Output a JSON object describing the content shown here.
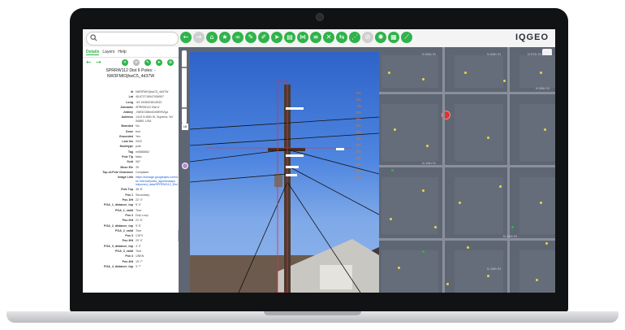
{
  "app": {
    "logo_text": "IQGEO",
    "brand_color": "#2fb34a",
    "search_icon": "search-icon"
  },
  "toolbar": {
    "tools": [
      {
        "icon": "back-icon",
        "glyph": "←"
      },
      {
        "icon": "forward-icon",
        "glyph": "→",
        "disabled": true
      },
      {
        "icon": "home-icon",
        "glyph": "⌂"
      },
      {
        "icon": "star-icon",
        "glyph": "★"
      },
      {
        "icon": "link-icon",
        "glyph": "∞"
      },
      {
        "icon": "edit-icon",
        "glyph": "✎"
      },
      {
        "icon": "pencil-icon",
        "glyph": "✐"
      },
      {
        "icon": "navigate-icon",
        "glyph": "➤"
      },
      {
        "icon": "print-icon",
        "glyph": "▤"
      },
      {
        "icon": "network-icon",
        "glyph": "⋈"
      },
      {
        "icon": "list-icon",
        "glyph": "≡"
      },
      {
        "icon": "tools-icon",
        "glyph": "✕"
      },
      {
        "icon": "shuffle-icon",
        "glyph": "⇆"
      },
      {
        "icon": "share-icon",
        "glyph": "⋰"
      },
      {
        "icon": "block-icon",
        "glyph": "⊘",
        "disabled": true
      },
      {
        "icon": "settings-icon",
        "glyph": "✺"
      },
      {
        "icon": "map-icon",
        "glyph": "▦"
      },
      {
        "icon": "measure-icon",
        "glyph": "⟋"
      }
    ]
  },
  "panel": {
    "tabs": [
      "Details",
      "Layers",
      "Help"
    ],
    "title_line1": "SPRRW112 Dist 6 Poles: -",
    "title_line2": "NW3FMIOjhwC5_4d37W",
    "details": [
      {
        "k": "Id",
        "v": "NW3FMIOjhwC5_4d37W"
      },
      {
        "k": "Lat",
        "v": "46.672716947006907"
      },
      {
        "k": "Long",
        "v": "-92.1926324814533"
      },
      {
        "k": "Jobname",
        "v": "SPRRW112 Dist 6"
      },
      {
        "k": "Jobkey",
        "v": "-NW3O38bmDx9lEfHZgz"
      },
      {
        "k": "Address",
        "v": "1415 N 56th St, Superior, WI 54880, USA"
      },
      {
        "k": "Branded",
        "v": "No"
      },
      {
        "k": "Done",
        "v": "true"
      },
      {
        "k": "Grounded",
        "v": "Yes"
      },
      {
        "k": "Last Ins",
        "v": "2022"
      },
      {
        "k": "Nodetype",
        "v": "pole"
      },
      {
        "k": "Tag",
        "v": "m5585662"
      },
      {
        "k": "Pole Tip",
        "v": "false"
      },
      {
        "k": "Scid",
        "v": "067"
      },
      {
        "k": "Mesn Ele",
        "v": "39"
      },
      {
        "k": "Top-of-Pole Clearance",
        "v": "Compliant"
      },
      {
        "k": "Image Link",
        "v": "https://storage.googleapis.com/dp-ke internal/poles_agent/katapu stkponed_data/SPRRW112_Dist_6_export/images/61.jpg",
        "link": true
      },
      {
        "k": "Pole Top",
        "v": "35' 8\""
      },
      {
        "k": "Pos 1",
        "v": "Secondary"
      },
      {
        "k": "Pos 1Ht",
        "v": "22' 4\""
      },
      {
        "k": "POA_1_distance_top",
        "v": "6' 4\""
      },
      {
        "k": "POA_1_valid",
        "v": "True"
      },
      {
        "k": "Pos 2",
        "v": "Drip Loop"
      },
      {
        "k": "Pos 2Ht",
        "v": "21' 6\""
      },
      {
        "k": "POA_2_distance_top",
        "v": "5' 6\""
      },
      {
        "k": "POA_2_valid",
        "v": "True"
      },
      {
        "k": "Pos 3",
        "v": "CATV"
      },
      {
        "k": "Pos 3Ht",
        "v": "20' 4\""
      },
      {
        "k": "POA_3_distance_top",
        "v": "4' 4\""
      },
      {
        "k": "POA_3_valid",
        "v": "True"
      },
      {
        "k": "Pos 4",
        "v": "UNKN"
      },
      {
        "k": "Pos 4Ht",
        "v": "19' 7\""
      },
      {
        "k": "POA_4_distance_top",
        "v": "3' 7\""
      }
    ]
  },
  "map": {
    "zoom_level": "18",
    "street_labels": [
      "N 55th St",
      "N 56th St",
      "N 57th St",
      "N 58th St",
      "N 15th St",
      "N 14th St",
      "N 16th St"
    ]
  },
  "photo": {
    "measurements": [
      "0%",
      "0%",
      "45",
      "0%",
      "0%",
      "0%",
      "0%",
      "0%",
      "0%",
      "0%",
      "0%",
      "0%",
      "0%",
      "0%"
    ]
  }
}
